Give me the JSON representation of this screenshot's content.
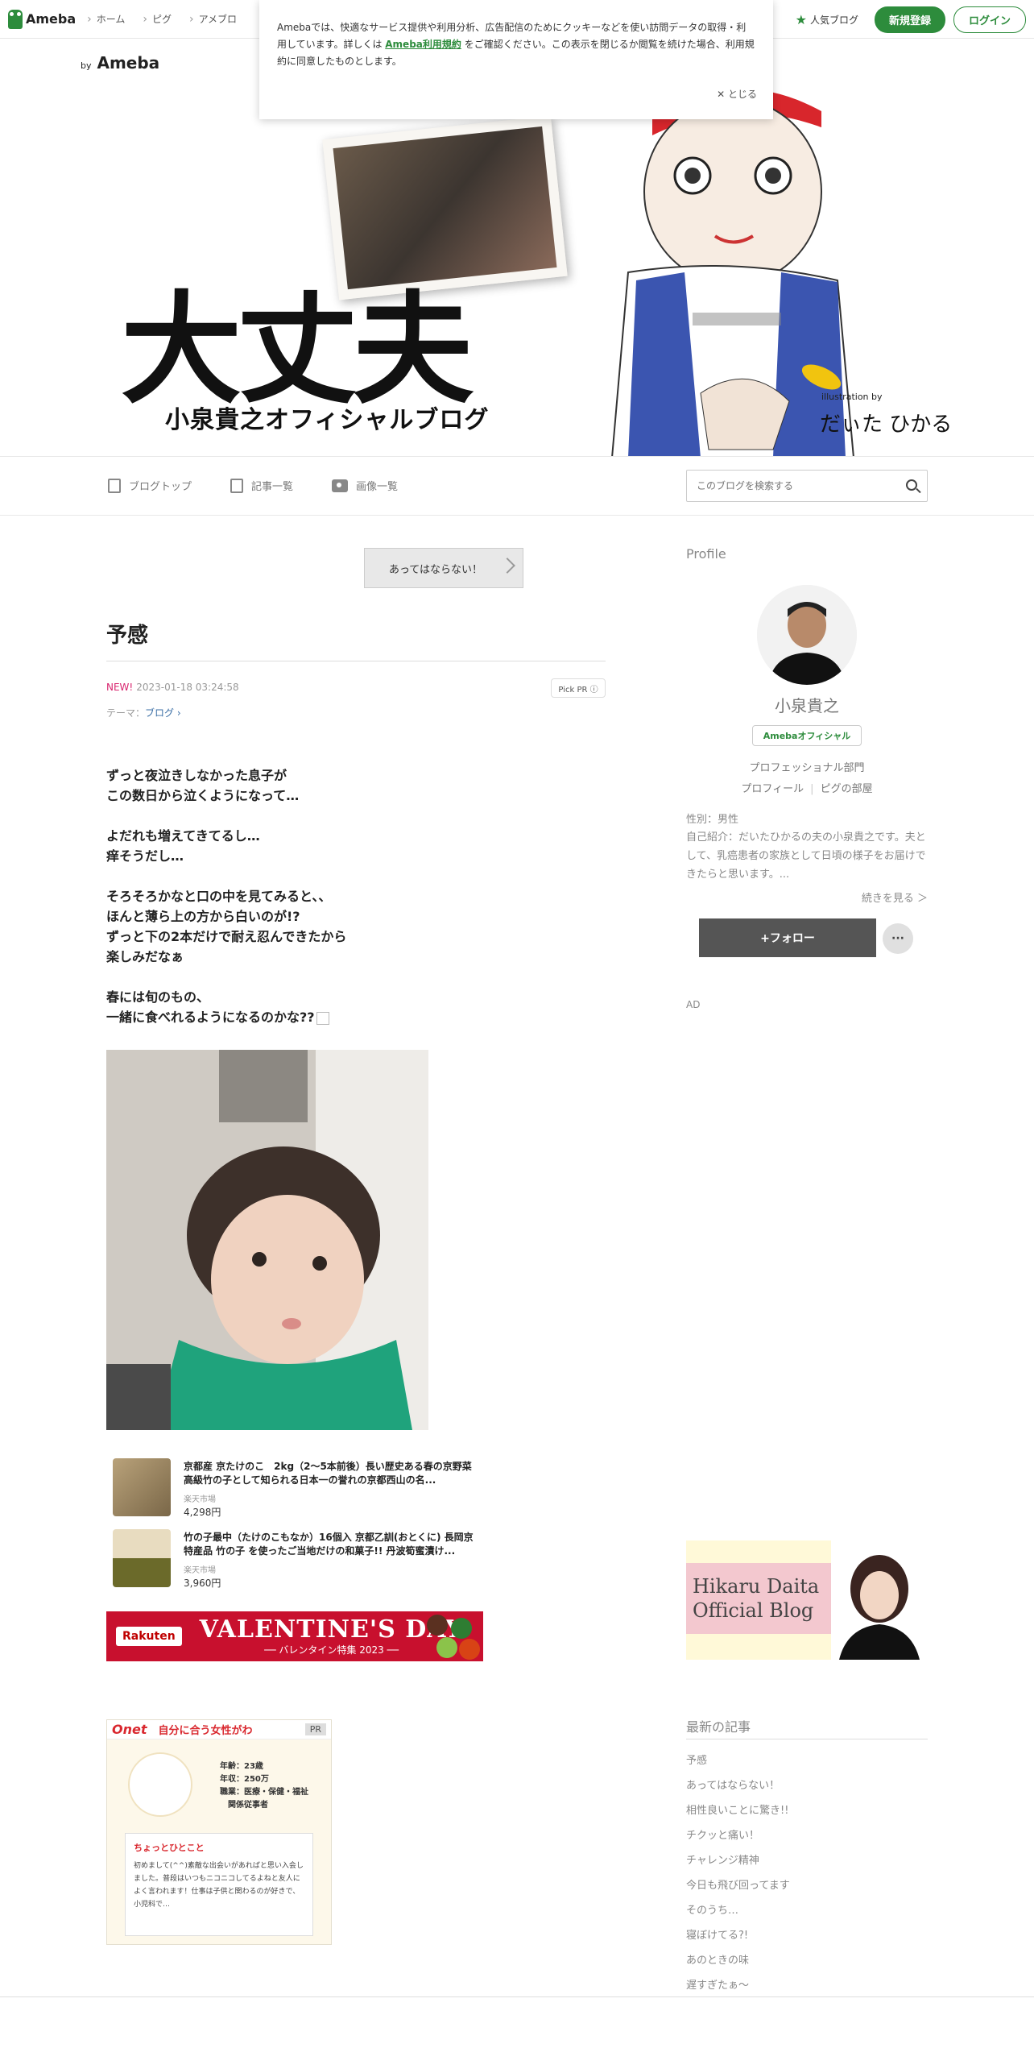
{
  "header": {
    "logo": "Ameba",
    "nav": [
      "ホーム",
      "ピグ",
      "アメブロ"
    ],
    "popular": "人気ブログ",
    "register": "新規登録",
    "login": "ログイン"
  },
  "cookie": {
    "text_before": "Amebaでは、快適なサービス提供や利用分析、広告配信のためにクッキーなどを使い訪問データの取得・利用しています。詳しくは ",
    "link": "Ameba利用規約",
    "text_after": " をご確認ください。この表示を閉じるか閲覧を続けた場合、利用規約に同意したものとします。",
    "close": "✕ とじる"
  },
  "banner": {
    "by": "by",
    "by_brand": "Ameba",
    "title": "大丈夫",
    "subtitle": "小泉貴之オフィシャルブログ",
    "illustration_by": "illustration by",
    "signature": "だぃた ひかる"
  },
  "blog_nav": {
    "items": [
      "ブログトップ",
      "記事一覧",
      "画像一覧"
    ],
    "search_placeholder": "このブログを検索する"
  },
  "article": {
    "prev_label": "あってはならない！",
    "title": "予感",
    "new_badge": "NEW!",
    "datetime": "2023-01-18 03:24:58",
    "pick_pr": "Pick PR ⓘ",
    "theme_label": "テーマ：",
    "theme_value": "ブログ",
    "paragraphs": [
      [
        "ずっと夜泣きしなかった息子が",
        "この数日から泣くようになって…"
      ],
      [
        "よだれも増えてきてるし…",
        "痒そうだし…"
      ],
      [
        "そろそろかなと口の中を見てみると、、",
        "ほんと薄ら上の方から白いのが!?",
        "ずっと下の2本だけで耐え忍んできたから",
        "楽しみだなぁ"
      ],
      [
        "春には旬のもの、",
        "一緒に食べれるようになるのかな??"
      ]
    ]
  },
  "products": [
    {
      "name": "京都産 京たけのこ　2kg（2〜5本前後）長い歴史ある春の京野菜　高級竹の子として知られる日本一の誉れの京都西山の名...",
      "shop": "楽天市場",
      "price": "4,298円"
    },
    {
      "name": "竹の子最中（たけのこもなか）16個入 京都乙訓(おとくに) 長岡京 特産品 竹の子 を使ったご当地だけの和菓子!! 丹波筍蜜漬け...",
      "shop": "楽天市場",
      "price": "3,960円"
    }
  ],
  "rakuten": {
    "logo": "Rakuten",
    "headline": "VALENTINE'S DAY",
    "sub": "── バレンタイン特集 2023 ──"
  },
  "onet": {
    "logo": "Onet",
    "headline": "自分に合う女性がわ",
    "pr": "PR",
    "stats": [
      "年齢：23歳",
      "年収：250万",
      "職業：医療・保健・福祉",
      "　関係従事者"
    ],
    "caption": "ちょっとひとこと",
    "message": "初めまして(^^)素敵な出会いがあればと思い入会しました。普段はいつもニコニコしてるよねと友人によく言われます！仕事は子供と関わるのが好きで、小児科で…"
  },
  "profile": {
    "heading": "Profile",
    "name": "小泉貴之",
    "badge": "Amebaオフィシャル",
    "category": "プロフェッショナル部門",
    "link1": "プロフィール",
    "link2": "ピグの部屋",
    "gender": "性別：男性",
    "intro": "自己紹介：だいたひかるの夫の小泉貴之です。夫として、乳癌患者の家族として日頃の様子をお届けできたらと思います。...",
    "more": "続きを見る ＞",
    "follow": "+フォロー",
    "menu": "···"
  },
  "sidebar_ad": "AD",
  "hikaru_banner": {
    "line1": "Hikaru Daita",
    "line2": "Official Blog"
  },
  "recent": {
    "heading": "最新の記事",
    "items": [
      "予感",
      "あってはならない！",
      "相性良いことに驚き!!",
      "チクッと痛い！",
      "チャレンジ精神",
      "今日も飛び回ってます",
      "そのうち…",
      "寝ぼけてる?!",
      "あのときの味",
      "遅すぎたぁ〜"
    ]
  },
  "colors": {
    "accent": "#2d8c3c",
    "new": "#d8246e",
    "rakuten": "#c8102e",
    "onet": "#d9272e"
  }
}
